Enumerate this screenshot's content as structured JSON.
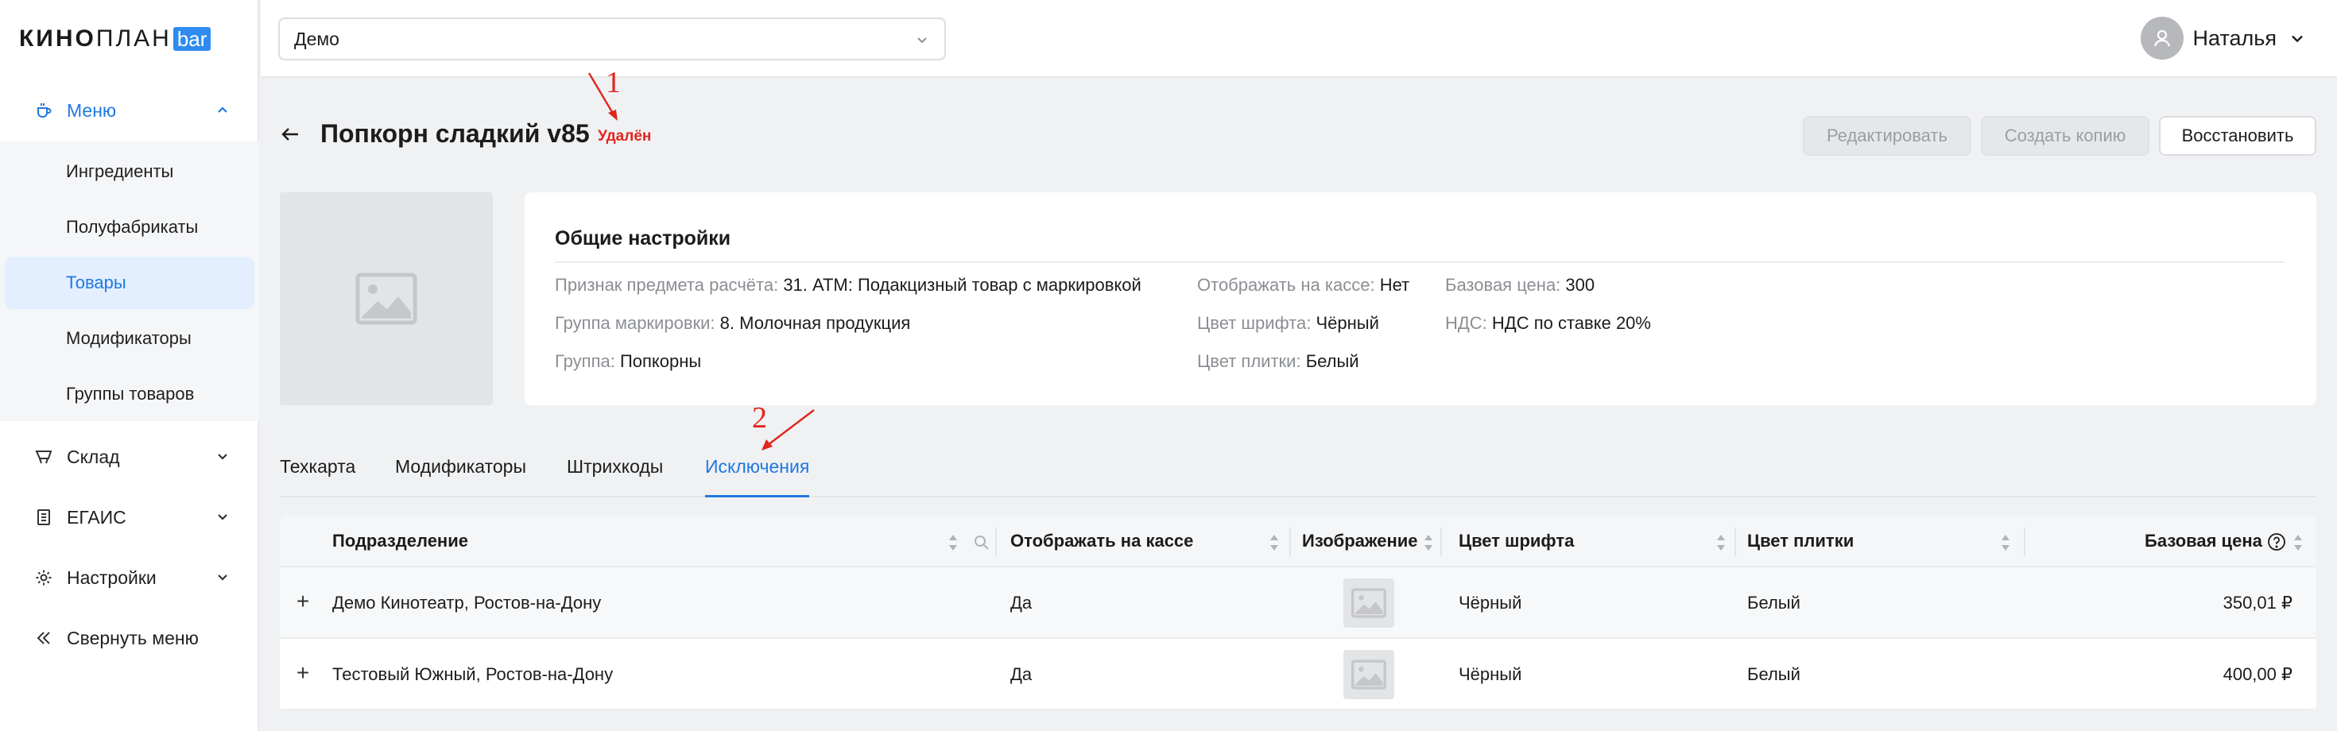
{
  "logo": {
    "brand_bold": "КИНО",
    "brand_thin": "ПЛАН",
    "brand_badge": "bar"
  },
  "sidebar": {
    "menu_label": "Меню",
    "submenu": [
      "Ингредиенты",
      "Полуфабрикаты",
      "Товары",
      "Модификаторы",
      "Группы товаров"
    ],
    "selected_submenu": "Товары",
    "sections": [
      "Склад",
      "ЕГАИС",
      "Настройки"
    ],
    "collapse_label": "Свернуть меню"
  },
  "topbar": {
    "cinema_value": "Демо",
    "user_name": "Наталья"
  },
  "header": {
    "title": "Попкорн сладкий v85",
    "status": "Удалён",
    "edit_label": "Редактировать",
    "copy_label": "Создать копию",
    "restore_label": "Восстановить"
  },
  "annotations": {
    "first": "1",
    "second": "2"
  },
  "settings": {
    "title": "Общие настройки",
    "fields": [
      {
        "key": "Признак предмета расчёта:",
        "value": "31. АТМ: Подакцизный товар с маркировкой"
      },
      {
        "key": "Группа маркировки:",
        "value": "8. Молочная продукция"
      },
      {
        "key": "Группа:",
        "value": "Попкорны"
      },
      {
        "key": "Отображать на кассе:",
        "value": "Нет"
      },
      {
        "key": "Цвет шрифта:",
        "value": "Чёрный"
      },
      {
        "key": "Цвет плитки:",
        "value": "Белый"
      },
      {
        "key": "Базовая цена:",
        "value": "300"
      },
      {
        "key": "НДС:",
        "value": "НДС по ставке 20%"
      }
    ]
  },
  "tabs": {
    "items": [
      "Техкарта",
      "Модификаторы",
      "Штрихкоды",
      "Исключения"
    ],
    "active": "Исключения"
  },
  "table": {
    "columns": [
      "Подразделение",
      "Отображать на кассе",
      "Изображение",
      "Цвет шрифта",
      "Цвет плитки",
      "Базовая цена"
    ],
    "rows": [
      {
        "division": "Демо Кинотеатр, Ростов-на-Дону",
        "show": "Да",
        "font_color": "Чёрный",
        "tile_color": "Белый",
        "price": "350,01 ₽"
      },
      {
        "division": "Тестовый Южный, Ростов-на-Дону",
        "show": "Да",
        "font_color": "Чёрный",
        "tile_color": "Белый",
        "price": "400,00 ₽"
      }
    ]
  },
  "colors": {
    "accent": "#2178e0",
    "danger": "#e0261d",
    "selected_bg": "#e3efff"
  },
  "icons": {
    "menu": "cup-icon",
    "warehouse": "cart-icon",
    "egais": "document-icon",
    "settings": "gear-icon",
    "collapse": "double-chevron-left-icon",
    "back": "arrow-left-icon",
    "search": "search-icon",
    "help": "question-circle-icon",
    "sort": "sort-icon",
    "image": "image-placeholder-icon",
    "expand": "plus-icon"
  }
}
